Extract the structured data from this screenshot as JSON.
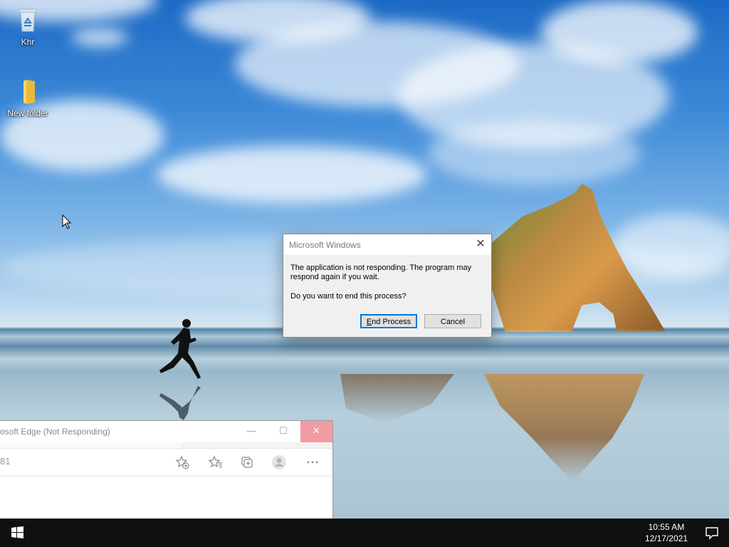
{
  "desktop": {
    "icons": [
      {
        "label": "Khr",
        "icon": "recycle-bin-icon"
      },
      {
        "label": "New folder",
        "icon": "folder-icon"
      }
    ]
  },
  "dialog": {
    "title": "Microsoft Windows",
    "message": "The application is not responding. The program may respond again if you wait.",
    "question": "Do you want to end this process?",
    "end_process_label": "End Process",
    "cancel_label": "Cancel"
  },
  "edge_window": {
    "title": "osoft Edge (Not Responding)",
    "address_fragment": "81",
    "toolbar_icons": [
      "add-favorite-icon",
      "favorites-icon",
      "collections-icon",
      "profile-icon",
      "more-icon"
    ]
  },
  "taskbar": {
    "time": "10:55 AM",
    "date": "12/17/2021"
  },
  "colors": {
    "taskbar": "#101010",
    "close_hover": "#f29ba3",
    "focus_blue": "#0078d7"
  }
}
